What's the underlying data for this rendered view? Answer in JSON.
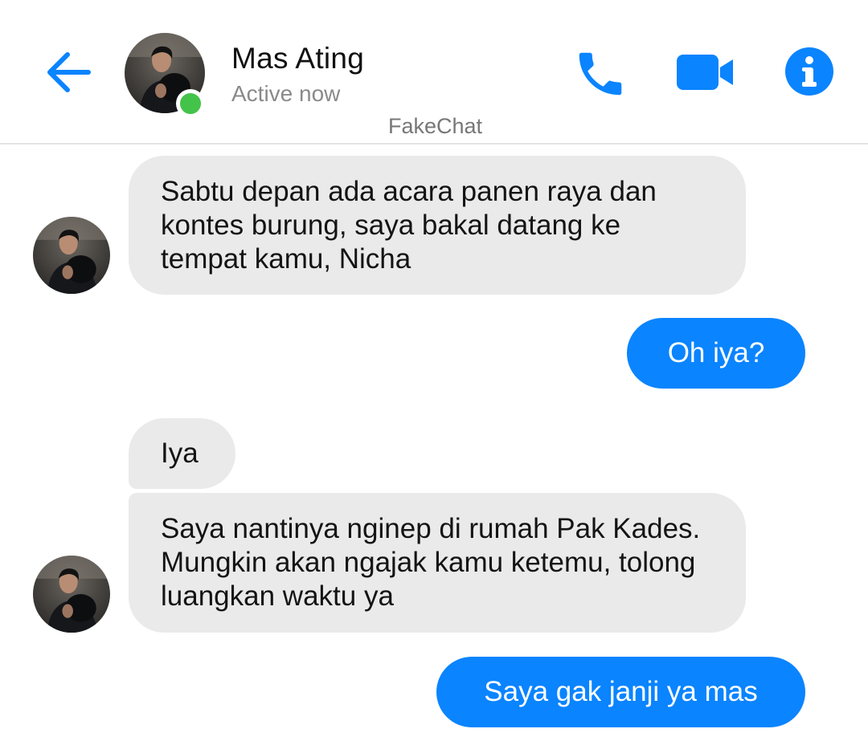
{
  "header": {
    "name": "Mas Ating",
    "status": "Active now",
    "watermark": "FakeChat",
    "icons": {
      "back": "arrow-left-icon",
      "call": "phone-icon",
      "video": "video-camera-icon",
      "info": "info-icon"
    }
  },
  "colors": {
    "accent": "#0a84ff",
    "incoming_bubble": "#eaeaea",
    "online": "#44c34a"
  },
  "messages": [
    {
      "from": "contact",
      "text": "Sabtu depan ada acara panen raya dan kontes burung, saya bakal datang ke tempat kamu, Nicha"
    },
    {
      "from": "me",
      "text": "Oh iya?"
    },
    {
      "from": "contact",
      "text": "Iya"
    },
    {
      "from": "contact",
      "text": "Saya nantinya nginep di rumah Pak Kades. Mungkin akan ngajak kamu ketemu, tolong luangkan waktu ya"
    },
    {
      "from": "me",
      "text": "Saya gak janji ya mas"
    }
  ]
}
